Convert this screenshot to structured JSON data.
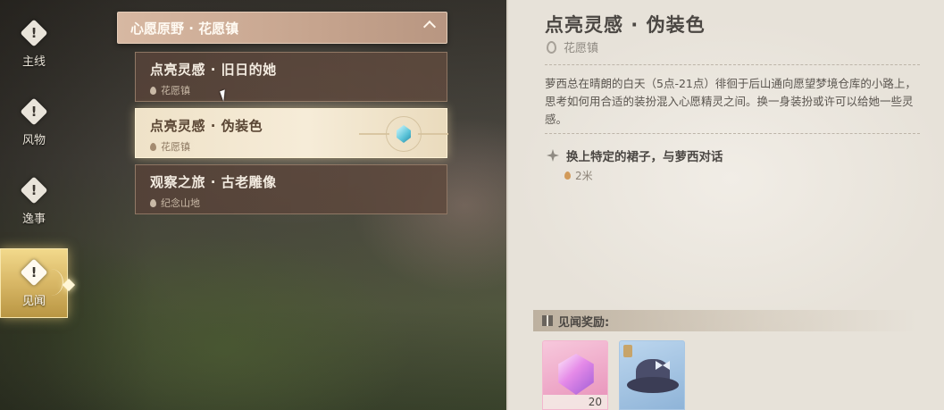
{
  "nav": {
    "items": [
      {
        "label": "主线",
        "icon": "exclamation-diamond-icon"
      },
      {
        "label": "风物",
        "icon": "exclamation-diamond-icon"
      },
      {
        "label": "逸事",
        "icon": "exclamation-diamond-icon"
      },
      {
        "label": "见闻",
        "icon": "exclamation-diamond-icon",
        "active": true
      }
    ]
  },
  "quest_list": {
    "region": "心愿原野 · 花愿镇",
    "quests": [
      {
        "title": "点亮灵感 · 旧日的她",
        "location": "花愿镇"
      },
      {
        "title": "点亮灵感 · 伪装色",
        "location": "花愿镇",
        "selected": true
      },
      {
        "title": "观察之旅 · 古老雕像",
        "location": "纪念山地"
      }
    ]
  },
  "detail": {
    "title": "点亮灵感 · 伪装色",
    "location": "花愿镇",
    "description": "萝西总在晴朗的白天（5点-21点）徘徊于后山通向愿望梦境仓库的小路上，思考如何用合适的装扮混入心愿精灵之间。换一身装扮或许可以给她一些灵感。",
    "objective": "换上特定的裙子，与萝西对话",
    "distance": "2米",
    "reward_label": "见闻奖励:",
    "rewards": [
      {
        "icon": "pink-crystal-icon",
        "quantity": "20"
      },
      {
        "icon": "bowler-hat-icon"
      }
    ]
  },
  "colors": {
    "active_nav": "#d8b766",
    "panel_bg": "#e7e2d9",
    "quest_card": "#5f4a3e",
    "selected_card": "#f6ecd8"
  }
}
